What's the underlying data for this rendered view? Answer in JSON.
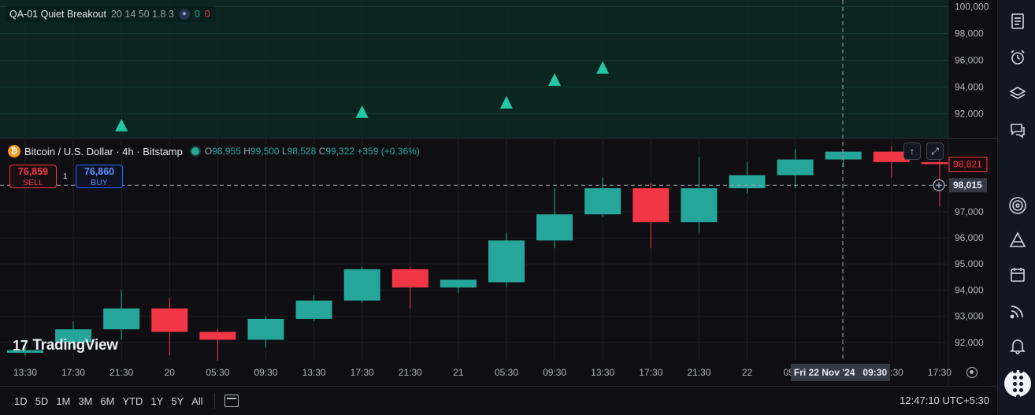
{
  "indicator": {
    "name": "QA-01 Quiet Breakout",
    "params": "20 14 50 1.8 3",
    "count_up": "0",
    "count_down": "0"
  },
  "symbol": {
    "title": "Bitcoin / U.S. Dollar · 4h · Bitstamp",
    "o_label": "O",
    "o": "98,955",
    "h_label": "H",
    "h": "99,500",
    "l_label": "L",
    "l": "98,528",
    "c_label": "C",
    "c": "99,322",
    "change": "+359 (+0.36%)"
  },
  "trade": {
    "sell_price": "76,859",
    "sell_label": "SELL",
    "buy_price": "76,860",
    "buy_label": "BUY",
    "qty": "1"
  },
  "crosshair": {
    "price": "98,015",
    "time_date": "Fri 22 Nov '24",
    "time_clock": "09:30"
  },
  "last_price": "98,821",
  "logo_text": "TradingView",
  "ranges": [
    "1D",
    "5D",
    "1M",
    "3M",
    "6M",
    "YTD",
    "1Y",
    "5Y",
    "All"
  ],
  "clock": "12:47:10 UTC+5:30",
  "colors": {
    "up": "#26a69a",
    "down": "#f23645",
    "signal": "#22c8a0",
    "bg": "#0f0f13"
  },
  "icons": [
    "watchlist-icon",
    "alarm-clock-icon",
    "layers-icon",
    "chat-icon",
    "target-icon",
    "ideas-icon",
    "calendar-icon",
    "signal-icon",
    "bell-icon",
    "apps-grid-icon"
  ],
  "chart_data": [
    {
      "type": "candlestick",
      "x": [
        "13:30",
        "17:30",
        "21:30",
        "20",
        "05:30",
        "09:30",
        "13:30",
        "17:30",
        "21:30",
        "21",
        "05:30",
        "09:30",
        "13:30",
        "17:30",
        "21:30",
        "22",
        "05:30",
        "09:30",
        "13:30",
        "17:30"
      ],
      "tick_labels": [
        "13:30",
        "17:30",
        "21:30",
        "20",
        "05:30",
        "09:30",
        "13:30",
        "17:30",
        "21:30",
        "21",
        "05:30",
        "09:30",
        "13:30",
        "17:30",
        "21:30",
        "22",
        "05:30",
        "09:30",
        "13:30",
        "17:30"
      ],
      "ohlc": [
        [
          91600,
          92100,
          91500,
          91700
        ],
        [
          92000,
          92800,
          91800,
          92500
        ],
        [
          92500,
          94000,
          92100,
          93300
        ],
        [
          93300,
          93700,
          91500,
          92400
        ],
        [
          92400,
          92500,
          91300,
          92100
        ],
        [
          92100,
          93000,
          91800,
          92900
        ],
        [
          92900,
          93800,
          92800,
          93600
        ],
        [
          93600,
          94900,
          93500,
          94800
        ],
        [
          94800,
          94900,
          93300,
          94100
        ],
        [
          94100,
          94400,
          93900,
          94400
        ],
        [
          94300,
          96200,
          94100,
          95900
        ],
        [
          95900,
          97900,
          95600,
          96900
        ],
        [
          96900,
          98300,
          96800,
          97900
        ],
        [
          97900,
          98100,
          95600,
          96600
        ],
        [
          96600,
          99100,
          96200,
          97900
        ],
        [
          97900,
          98900,
          97700,
          98400
        ],
        [
          98400,
          99400,
          97900,
          99000
        ],
        [
          99000,
          99300,
          98700,
          99300
        ],
        [
          99300,
          99500,
          98300,
          98900
        ],
        [
          98900,
          99200,
          97200,
          98821
        ]
      ],
      "y_ticks": [
        92000,
        93000,
        94000,
        95000,
        96000,
        97000
      ],
      "ylim": [
        91300,
        99800
      ],
      "last_price": 98821,
      "crosshair_price": 98015
    },
    {
      "type": "scatter",
      "name": "QA-01 Quiet Breakout",
      "marker": "triangle-up",
      "x_index": [
        2,
        7,
        10,
        11,
        12
      ],
      "y": [
        91100,
        92100,
        92800,
        94500,
        95400
      ],
      "y_ticks": [
        92000,
        94000,
        96000,
        98000,
        100000
      ],
      "ylim": [
        90200,
        100500
      ]
    }
  ]
}
